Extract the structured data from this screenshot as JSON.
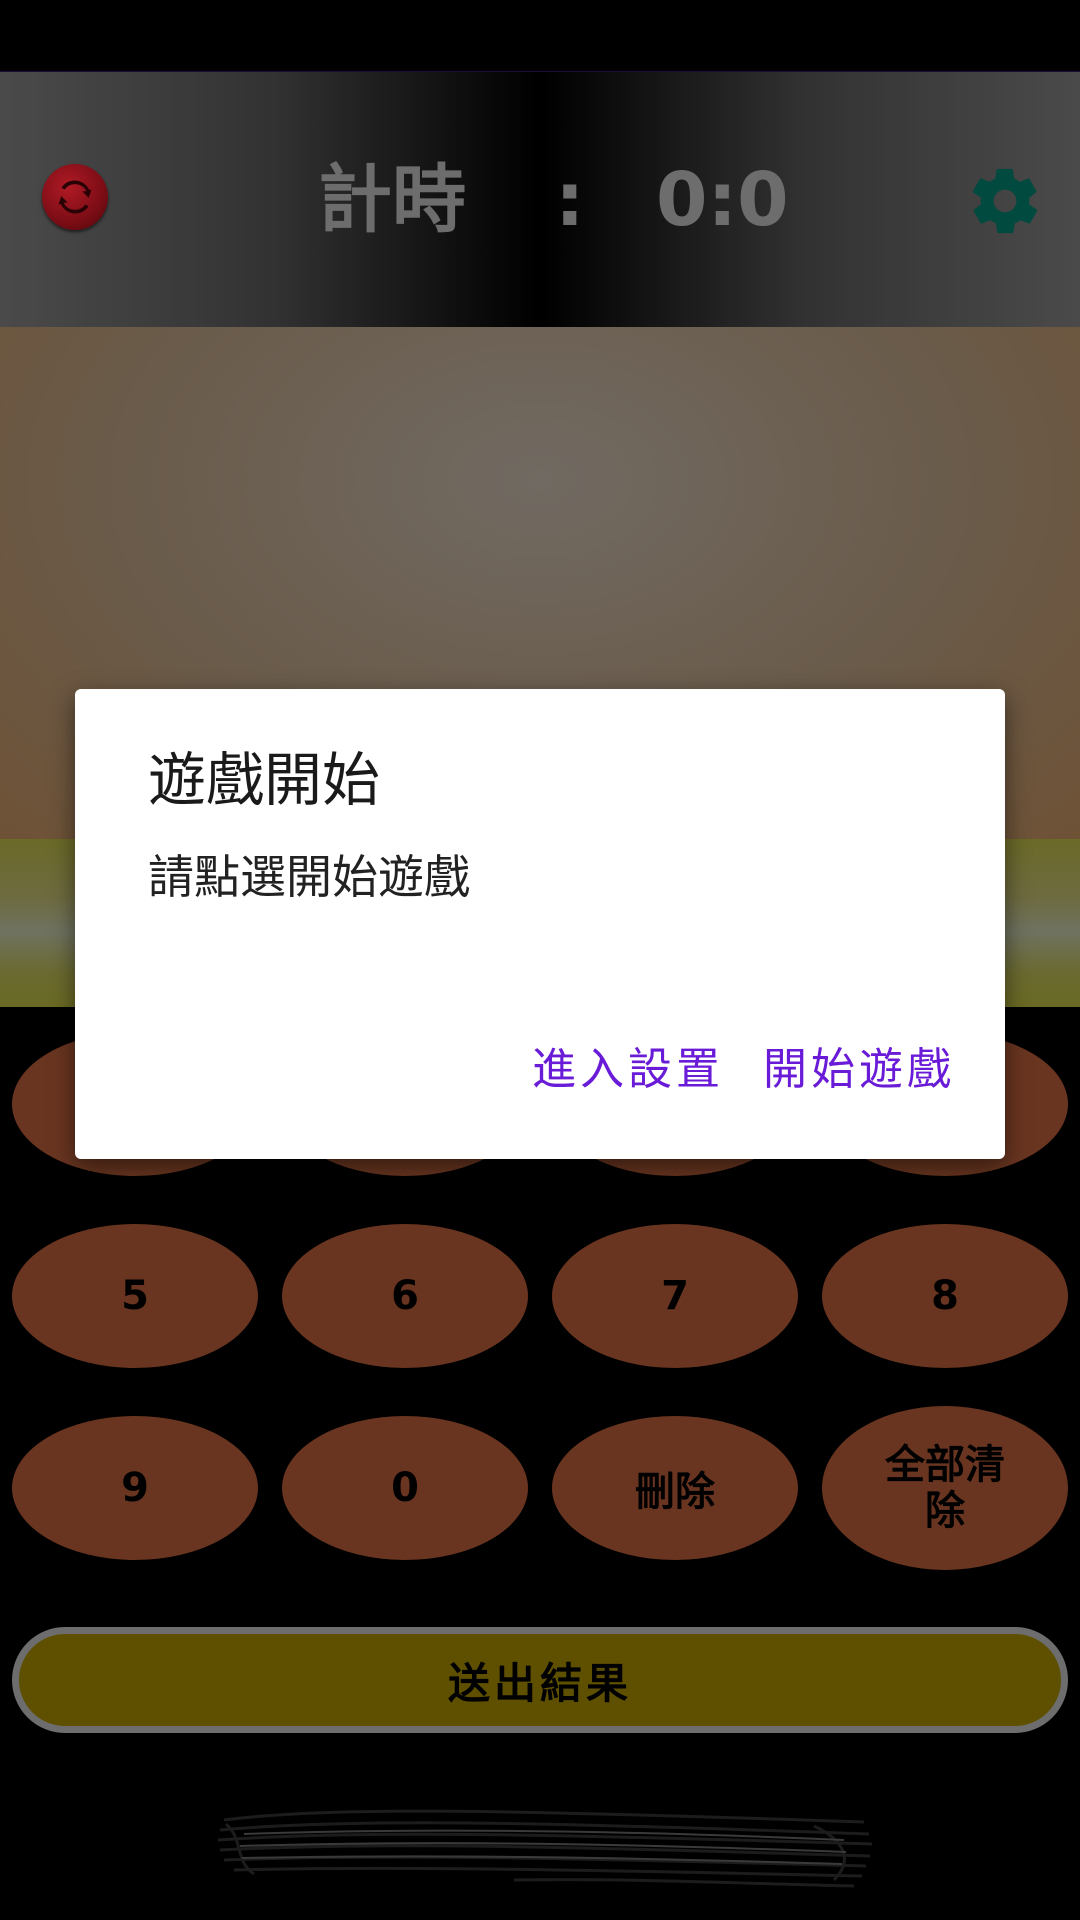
{
  "header": {
    "timer_label": "計時",
    "timer_separator": ":",
    "timer_value": "0:0",
    "refresh_icon": "refresh-icon",
    "settings_icon": "gear-icon",
    "refresh_color": "#8f121c",
    "settings_color": "#004a40"
  },
  "keypad": {
    "keys": [
      "5",
      "6",
      "7",
      "8",
      "9",
      "0",
      "刪除",
      "全部清除"
    ],
    "key_color": "#693520"
  },
  "submit": {
    "label": "送出結果",
    "color": "#5f5000"
  },
  "dialog": {
    "title": "遊戲開始",
    "message": "請點選開始遊戲",
    "actions": {
      "settings": "進入設置",
      "start": "開始遊戲"
    },
    "accent_color": "#6a1bd8"
  }
}
